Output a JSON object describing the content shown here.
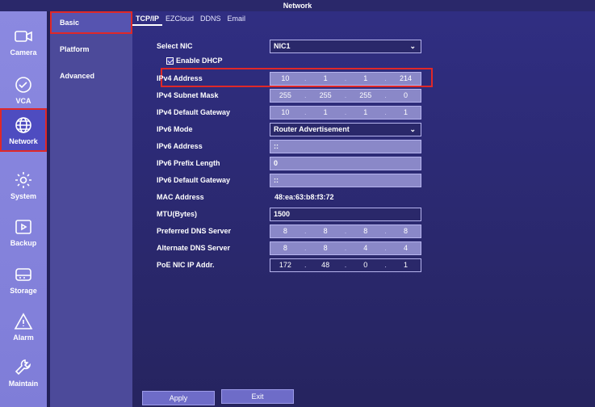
{
  "window": {
    "title": "Network"
  },
  "leftnav": {
    "items": [
      {
        "label": "Camera",
        "icon": "camera-icon"
      },
      {
        "label": "VCA",
        "icon": "vca-icon"
      },
      {
        "label": "Network",
        "icon": "globe-icon"
      },
      {
        "label": "System",
        "icon": "gear-icon"
      },
      {
        "label": "Backup",
        "icon": "backup-icon"
      },
      {
        "label": "Storage",
        "icon": "storage-icon"
      },
      {
        "label": "Alarm",
        "icon": "alarm-icon"
      },
      {
        "label": "Maintain",
        "icon": "wrench-icon"
      }
    ]
  },
  "subnav": {
    "items": [
      {
        "label": "Basic"
      },
      {
        "label": "Platform"
      },
      {
        "label": "Advanced"
      }
    ]
  },
  "tabs": [
    "TCP/IP",
    "EZCloud",
    "DDNS",
    "Email"
  ],
  "form": {
    "select_nic": {
      "label": "Select NIC",
      "value": "NIC1"
    },
    "enable_dhcp": {
      "label": "Enable DHCP",
      "checked": true
    },
    "ipv4_address": {
      "label": "IPv4 Address",
      "octets": [
        "10",
        "1",
        "1",
        "214"
      ]
    },
    "ipv4_subnet": {
      "label": "IPv4 Subnet Mask",
      "octets": [
        "255",
        "255",
        "255",
        "0"
      ]
    },
    "ipv4_gateway": {
      "label": "IPv4 Default Gateway",
      "octets": [
        "10",
        "1",
        "1",
        "1"
      ]
    },
    "ipv6_mode": {
      "label": "IPv6 Mode",
      "value": "Router Advertisement"
    },
    "ipv6_address": {
      "label": "IPv6 Address",
      "value": "::"
    },
    "ipv6_prefix": {
      "label": "IPv6 Prefix Length",
      "value": "0"
    },
    "ipv6_gateway": {
      "label": "IPv6 Default Gateway",
      "value": "::"
    },
    "mac_address": {
      "label": "MAC Address",
      "value": "48:ea:63:b8:f3:72"
    },
    "mtu": {
      "label": "MTU(Bytes)",
      "value": "1500"
    },
    "preferred_dns": {
      "label": "Preferred DNS Server",
      "octets": [
        "8",
        "8",
        "8",
        "8"
      ]
    },
    "alternate_dns": {
      "label": "Alternate DNS Server",
      "octets": [
        "8",
        "8",
        "4",
        "4"
      ]
    },
    "poe_ip": {
      "label": "PoE NIC IP Addr.",
      "octets": [
        "172",
        "48",
        "0",
        "1"
      ]
    }
  },
  "buttons": {
    "apply": "Apply",
    "exit": "Exit"
  },
  "colors": {
    "highlight": "#e02828",
    "accent": "#4e4cc0"
  }
}
